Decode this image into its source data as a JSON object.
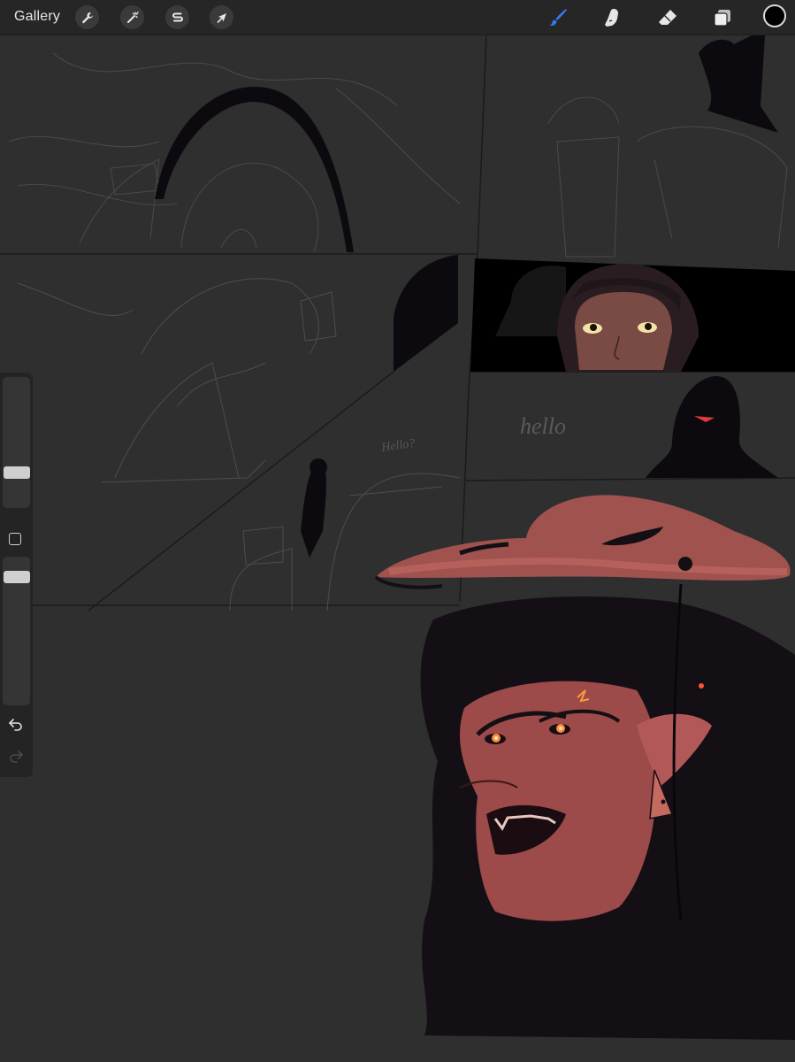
{
  "toolbar": {
    "gallery_label": "Gallery",
    "left_tools": [
      {
        "name": "actions",
        "icon": "wrench-icon"
      },
      {
        "name": "adjustments",
        "icon": "magic-wand-icon"
      },
      {
        "name": "selection",
        "icon": "selection-s-icon"
      },
      {
        "name": "transform",
        "icon": "arrow-cursor-icon"
      }
    ],
    "right_tools": [
      {
        "name": "brush",
        "icon": "brush-icon",
        "active": true
      },
      {
        "name": "smudge",
        "icon": "smudge-finger-icon",
        "active": false
      },
      {
        "name": "eraser",
        "icon": "eraser-icon",
        "active": false
      },
      {
        "name": "layers",
        "icon": "layers-icon",
        "active": false
      }
    ],
    "current_color": "#000000",
    "accent_color": "#2f7cf6"
  },
  "sidebar": {
    "brush_size_level": 0.25,
    "opacity_level": 0.15,
    "modify_button_icon": "square-icon",
    "undo_icon": "undo-icon",
    "redo_icon": "redo-icon"
  },
  "canvas": {
    "text_hello_1": "Hello?",
    "text_hello_2": "hello"
  }
}
